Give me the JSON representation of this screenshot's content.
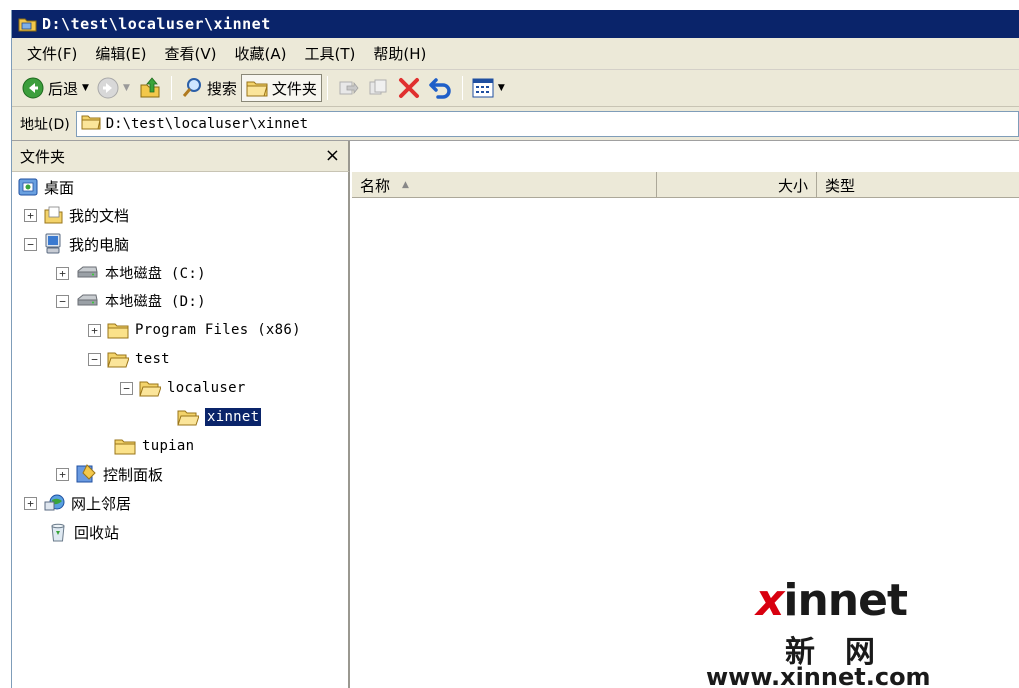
{
  "window": {
    "title": "D:\\test\\localuser\\xinnet"
  },
  "menu": [
    {
      "label": "文件(F)"
    },
    {
      "label": "编辑(E)"
    },
    {
      "label": "查看(V)"
    },
    {
      "label": "收藏(A)"
    },
    {
      "label": "工具(T)"
    },
    {
      "label": "帮助(H)"
    }
  ],
  "toolbar": {
    "back_label": "后退",
    "search_label": "搜索",
    "folders_label": "文件夹"
  },
  "address": {
    "label": "地址(D)",
    "value": "D:\\test\\localuser\\xinnet"
  },
  "folder_pane": {
    "title": "文件夹",
    "close": "×"
  },
  "tree": [
    {
      "label": "桌面",
      "icon": "desktop-icon",
      "expander": ""
    },
    {
      "label": "我的文档",
      "icon": "my-documents-icon",
      "expander": "+"
    },
    {
      "label": "我的电脑",
      "icon": "my-computer-icon",
      "expander": "−"
    },
    {
      "label": "本地磁盘 (C:)",
      "icon": "drive-icon",
      "expander": "+"
    },
    {
      "label": "本地磁盘 (D:)",
      "icon": "drive-icon",
      "expander": "−"
    },
    {
      "label": "Program Files (x86)",
      "icon": "folder-icon",
      "expander": "+"
    },
    {
      "label": "test",
      "icon": "folder-open-icon",
      "expander": "−"
    },
    {
      "label": "localuser",
      "icon": "folder-open-icon",
      "expander": "−"
    },
    {
      "label": "xinnet",
      "icon": "folder-open-icon",
      "expander": "",
      "selected": true
    },
    {
      "label": "tupian",
      "icon": "folder-icon",
      "expander": ""
    },
    {
      "label": "控制面板",
      "icon": "control-panel-icon",
      "expander": "+"
    },
    {
      "label": "网上邻居",
      "icon": "network-icon",
      "expander": "+"
    },
    {
      "label": "回收站",
      "icon": "recycle-bin-icon",
      "expander": ""
    }
  ],
  "columns": {
    "name": "名称",
    "size": "大小",
    "type": "类型"
  },
  "watermark": {
    "brand": "xinnet",
    "cn": "新网",
    "url": "www.xinnet.com"
  },
  "colors": {
    "titlebar": "#0a246a",
    "chrome": "#ece9d8",
    "selection": "#0a246a",
    "folder": "#f3d36b",
    "delete_red": "#e03030"
  }
}
